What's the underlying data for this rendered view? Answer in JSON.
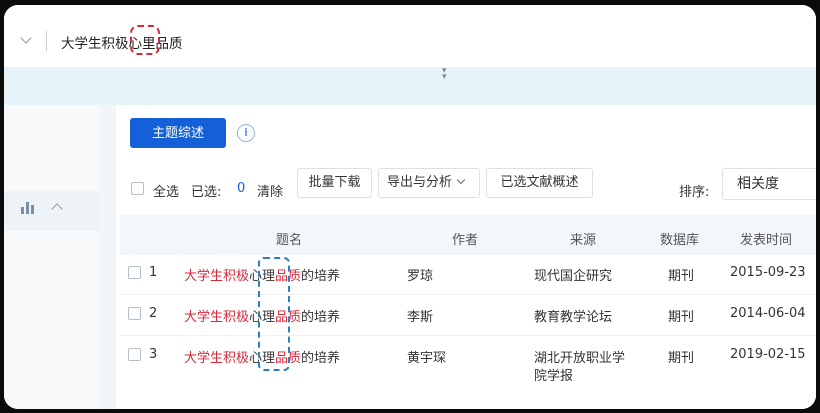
{
  "search": {
    "query": "大学生积极心里品质"
  },
  "toolbar": {
    "topic_review_label": "主题综述",
    "info_icon_glyph": "i",
    "select_all_label": "全选",
    "selected_label": "已选:",
    "selected_count": "0",
    "clear_label": "清除",
    "batch_download_label": "批量下载",
    "export_analysis_label": "导出与分析",
    "selected_review_label": "已选文献概述",
    "sort_label": "排序:",
    "sort_value": "相关度"
  },
  "table": {
    "headers": {
      "title": "题名",
      "author": "作者",
      "source": "来源",
      "database": "数据库",
      "date": "发表时间"
    },
    "rows": [
      {
        "num": "1",
        "title_hl1": "大学生积极",
        "title_mid": "心理",
        "title_hl2": "品质",
        "title_rest": "的培养",
        "author": "罗琼",
        "source_line1": "现代国企研究",
        "source_line2": "",
        "database": "期刊",
        "date": "2015-09-23"
      },
      {
        "num": "2",
        "title_hl1": "大学生积极",
        "title_mid": "心理",
        "title_hl2": "品质",
        "title_rest": "的培养",
        "author": "李斯",
        "source_line1": "教育教学论坛",
        "source_line2": "",
        "database": "期刊",
        "date": "2014-06-04"
      },
      {
        "num": "3",
        "title_hl1": "大学生积极",
        "title_mid": "心理",
        "title_hl2": "品质",
        "title_rest": "的培养",
        "author": "黄宇琛",
        "source_line1": "湖北开放职业学",
        "source_line2": "院学报",
        "database": "期刊",
        "date": "2019-02-15"
      }
    ]
  },
  "colors": {
    "accent": "#1360d8",
    "highlight": "#d9283a",
    "annotation_red": "#d9283a",
    "annotation_blue": "#2f7fc0"
  },
  "icons": [
    "chevron-down-icon",
    "collapse-handle-icon",
    "bar-chart-icon",
    "chevron-up-icon",
    "info-icon"
  ]
}
